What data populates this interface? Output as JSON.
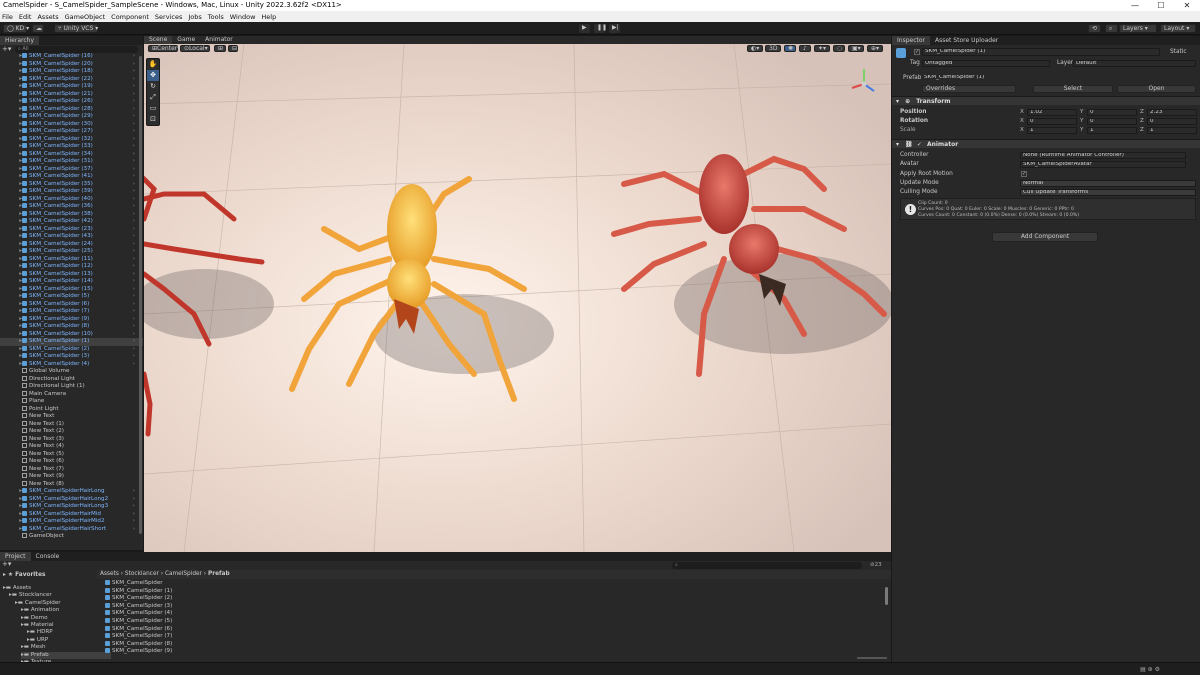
{
  "window": {
    "title": "CamelSpider - S_CamelSpider_SampleScene - Windows, Mac, Linux - Unity 2022.3.62f2 <DX11>"
  },
  "menu": [
    "File",
    "Edit",
    "Assets",
    "GameObject",
    "Component",
    "Services",
    "Jobs",
    "Tools",
    "Window",
    "Help"
  ],
  "toolbar": {
    "account": "KD",
    "vcs": "Unity VCS",
    "layers": "Layers",
    "layout": "Layout"
  },
  "hierarchy": {
    "tab": "Hierarchy",
    "search_placeholder": "All",
    "rows": [
      {
        "label": "SKM_CamelSpider (16)",
        "prefab": true
      },
      {
        "label": "SKM_CamelSpider (20)",
        "prefab": true
      },
      {
        "label": "SKM_CamelSpider (18)",
        "prefab": true
      },
      {
        "label": "SKM_CamelSpider (22)",
        "prefab": true
      },
      {
        "label": "SKM_CamelSpider (19)",
        "prefab": true
      },
      {
        "label": "SKM_CamelSpider (21)",
        "prefab": true
      },
      {
        "label": "SKM_CamelSpider (26)",
        "prefab": true
      },
      {
        "label": "SKM_CamelSpider (28)",
        "prefab": true
      },
      {
        "label": "SKM_CamelSpider (29)",
        "prefab": true
      },
      {
        "label": "SKM_CamelSpider (30)",
        "prefab": true
      },
      {
        "label": "SKM_CamelSpider (27)",
        "prefab": true
      },
      {
        "label": "SKM_CamelSpider (32)",
        "prefab": true
      },
      {
        "label": "SKM_CamelSpider (33)",
        "prefab": true
      },
      {
        "label": "SKM_CamelSpider (34)",
        "prefab": true
      },
      {
        "label": "SKM_CamelSpider (31)",
        "prefab": true
      },
      {
        "label": "SKM_CamelSpider (37)",
        "prefab": true
      },
      {
        "label": "SKM_CamelSpider (41)",
        "prefab": true
      },
      {
        "label": "SKM_CamelSpider (35)",
        "prefab": true
      },
      {
        "label": "SKM_CamelSpider (39)",
        "prefab": true
      },
      {
        "label": "SKM_CamelSpider (40)",
        "prefab": true
      },
      {
        "label": "SKM_CamelSpider (36)",
        "prefab": true
      },
      {
        "label": "SKM_CamelSpider (38)",
        "prefab": true
      },
      {
        "label": "SKM_CamelSpider (42)",
        "prefab": true
      },
      {
        "label": "SKM_CamelSpider (23)",
        "prefab": true
      },
      {
        "label": "SKM_CamelSpider (43)",
        "prefab": true
      },
      {
        "label": "SKM_CamelSpider (24)",
        "prefab": true
      },
      {
        "label": "SKM_CamelSpider (25)",
        "prefab": true
      },
      {
        "label": "SKM_CamelSpider (11)",
        "prefab": true
      },
      {
        "label": "SKM_CamelSpider (12)",
        "prefab": true
      },
      {
        "label": "SKM_CamelSpider (13)",
        "prefab": true
      },
      {
        "label": "SKM_CamelSpider (14)",
        "prefab": true
      },
      {
        "label": "SKM_CamelSpider (15)",
        "prefab": true
      },
      {
        "label": "SKM_CamelSpider (5)",
        "prefab": true
      },
      {
        "label": "SKM_CamelSpider (6)",
        "prefab": true
      },
      {
        "label": "SKM_CamelSpider (7)",
        "prefab": true
      },
      {
        "label": "SKM_CamelSpider (9)",
        "prefab": true
      },
      {
        "label": "SKM_CamelSpider (8)",
        "prefab": true
      },
      {
        "label": "SKM_CamelSpider (10)",
        "prefab": true
      },
      {
        "label": "SKM_CamelSpider (1)",
        "prefab": true,
        "selected": true
      },
      {
        "label": "SKM_CamelSpider (2)",
        "prefab": true
      },
      {
        "label": "SKM_CamelSpider (3)",
        "prefab": true
      },
      {
        "label": "SKM_CamelSpider (4)",
        "prefab": true
      },
      {
        "label": "Global Volume",
        "prefab": false
      },
      {
        "label": "Directional Light",
        "prefab": false
      },
      {
        "label": "Directional Light (1)",
        "prefab": false
      },
      {
        "label": "Main Camera",
        "prefab": false
      },
      {
        "label": "Plane",
        "prefab": false
      },
      {
        "label": "Point Light",
        "prefab": false
      },
      {
        "label": "New Text",
        "prefab": false
      },
      {
        "label": "New Text (1)",
        "prefab": false
      },
      {
        "label": "New Text (2)",
        "prefab": false
      },
      {
        "label": "New Text (3)",
        "prefab": false
      },
      {
        "label": "New Text (4)",
        "prefab": false
      },
      {
        "label": "New Text (5)",
        "prefab": false
      },
      {
        "label": "New Text (6)",
        "prefab": false
      },
      {
        "label": "New Text (7)",
        "prefab": false
      },
      {
        "label": "New Text (9)",
        "prefab": false
      },
      {
        "label": "New Text (8)",
        "prefab": false
      },
      {
        "label": "SKM_CamelSpiderHairLong",
        "prefab": true
      },
      {
        "label": "SKM_CamelSpiderHairLong2",
        "prefab": true
      },
      {
        "label": "SKM_CamelSpiderHairLong3",
        "prefab": true
      },
      {
        "label": "SKM_CamelSpiderHairMid",
        "prefab": true
      },
      {
        "label": "SKM_CamelSpiderHairMid2",
        "prefab": true
      },
      {
        "label": "SKM_CamelSpiderHairShort",
        "prefab": true
      },
      {
        "label": "GameObject",
        "prefab": false
      }
    ]
  },
  "scene": {
    "tabs": [
      "Scene",
      "Game",
      "Animator"
    ],
    "pivot": "Center",
    "space": "Local",
    "mode_2d_3d": "3D"
  },
  "inspector": {
    "tabs": [
      "Inspector",
      "Asset Store Uploader"
    ],
    "object_name": "SKM_CamelSpider (1)",
    "static_label": "Static",
    "tag_label": "Tag",
    "tag_value": "Untagged",
    "layer_label": "Layer",
    "layer_value": "Default",
    "prefab_label": "Prefab",
    "prefab_value": "SKM_CamelSpider (1)",
    "overrides": "Overrides",
    "select": "Select",
    "open": "Open",
    "transform": {
      "title": "Transform",
      "position_label": "Position",
      "rotation_label": "Rotation",
      "scale_label": "Scale",
      "position": {
        "x": "1.02",
        "y": "0",
        "z": "2.23"
      },
      "rotation": {
        "x": "0",
        "y": "0",
        "z": "0"
      },
      "scale": {
        "x": "1",
        "y": "1",
        "z": "1"
      }
    },
    "animator": {
      "title": "Animator",
      "controller_label": "Controller",
      "controller_value": "None (Runtime Animator Controller)",
      "avatar_label": "Avatar",
      "avatar_value": "SKM_CamelSpiderAvatar",
      "root_motion_label": "Apply Root Motion",
      "update_mode_label": "Update Mode",
      "update_mode_value": "Normal",
      "culling_label": "Culling Mode",
      "culling_value": "Cull Update Transforms",
      "info_line1": "Clip Count: 0",
      "info_line2": "Curves Pos: 0 Quat: 0 Euler: 0 Scale: 0 Muscles: 0 Generic: 0 PPtr: 0",
      "info_line3": "Curves Count: 0 Constant: 0 (0.0%) Dense: 0 (0.0%) Stream: 0 (0.0%)"
    },
    "add_component": "Add Component"
  },
  "project": {
    "tabs": [
      "Project",
      "Console"
    ],
    "favorites": "Favorites",
    "folders": [
      {
        "label": "Assets",
        "depth": 0
      },
      {
        "label": "Stocklancer",
        "depth": 1
      },
      {
        "label": "CamelSpider",
        "depth": 2
      },
      {
        "label": "Animation",
        "depth": 3
      },
      {
        "label": "Demo",
        "depth": 3
      },
      {
        "label": "Material",
        "depth": 3
      },
      {
        "label": "HDRP",
        "depth": 4
      },
      {
        "label": "URP",
        "depth": 4
      },
      {
        "label": "Mesh",
        "depth": 3
      },
      {
        "label": "Prefab",
        "depth": 3
      },
      {
        "label": "Texture",
        "depth": 3
      }
    ],
    "breadcrumb": [
      "Assets",
      "Stocklancer",
      "CamelSpider",
      "Prefab"
    ],
    "files": [
      "SKM_CamelSpider",
      "SKM_CamelSpider (1)",
      "SKM_CamelSpider (2)",
      "SKM_CamelSpider (3)",
      "SKM_CamelSpider (4)",
      "SKM_CamelSpider (5)",
      "SKM_CamelSpider (6)",
      "SKM_CamelSpider (7)",
      "SKM_CamelSpider (8)",
      "SKM_CamelSpider (9)"
    ],
    "count": "23"
  }
}
